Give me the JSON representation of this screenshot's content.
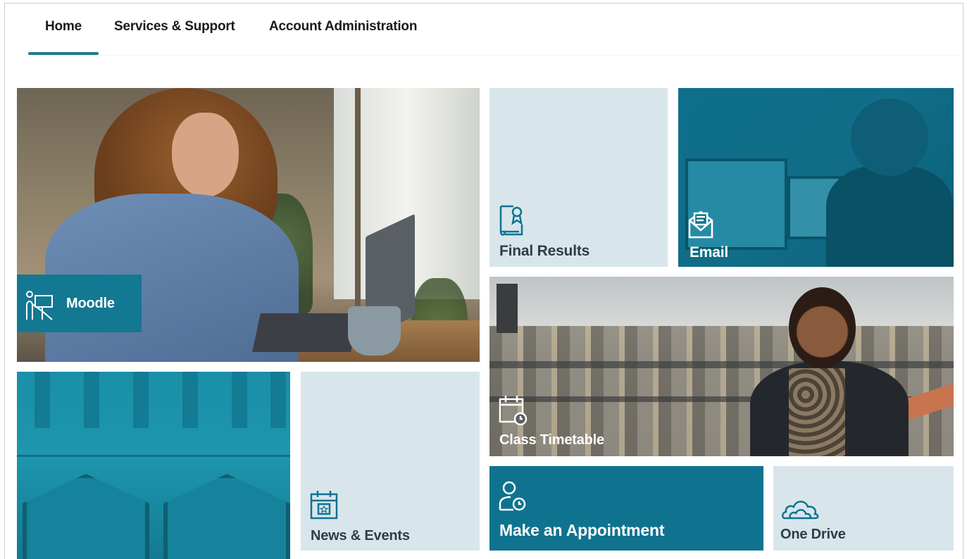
{
  "nav": {
    "tabs": [
      {
        "label": "Home",
        "active": true
      },
      {
        "label": "Services & Support",
        "active": false
      },
      {
        "label": "Account Administration",
        "active": false
      }
    ]
  },
  "tiles": {
    "moodle": {
      "label": "Moodle",
      "icon": "teacher-board-icon"
    },
    "final_results": {
      "label": "Final Results",
      "icon": "certificate-icon"
    },
    "email": {
      "label": "Email",
      "icon": "envelope-icon"
    },
    "class_timetable": {
      "label": "Class Timetable",
      "icon": "calendar-clock-icon"
    },
    "news_events": {
      "label": "News & Events",
      "icon": "calendar-star-icon"
    },
    "make_appointment": {
      "label": "Make an Appointment",
      "icon": "person-clock-icon"
    },
    "one_drive": {
      "label": "One Drive",
      "icon": "cloud-icon"
    }
  },
  "colors": {
    "accent": "#1b7b95",
    "tile_dark": "#0f7390",
    "tile_light": "#d8e6ec",
    "label_dark_text": "#2c3e48"
  }
}
